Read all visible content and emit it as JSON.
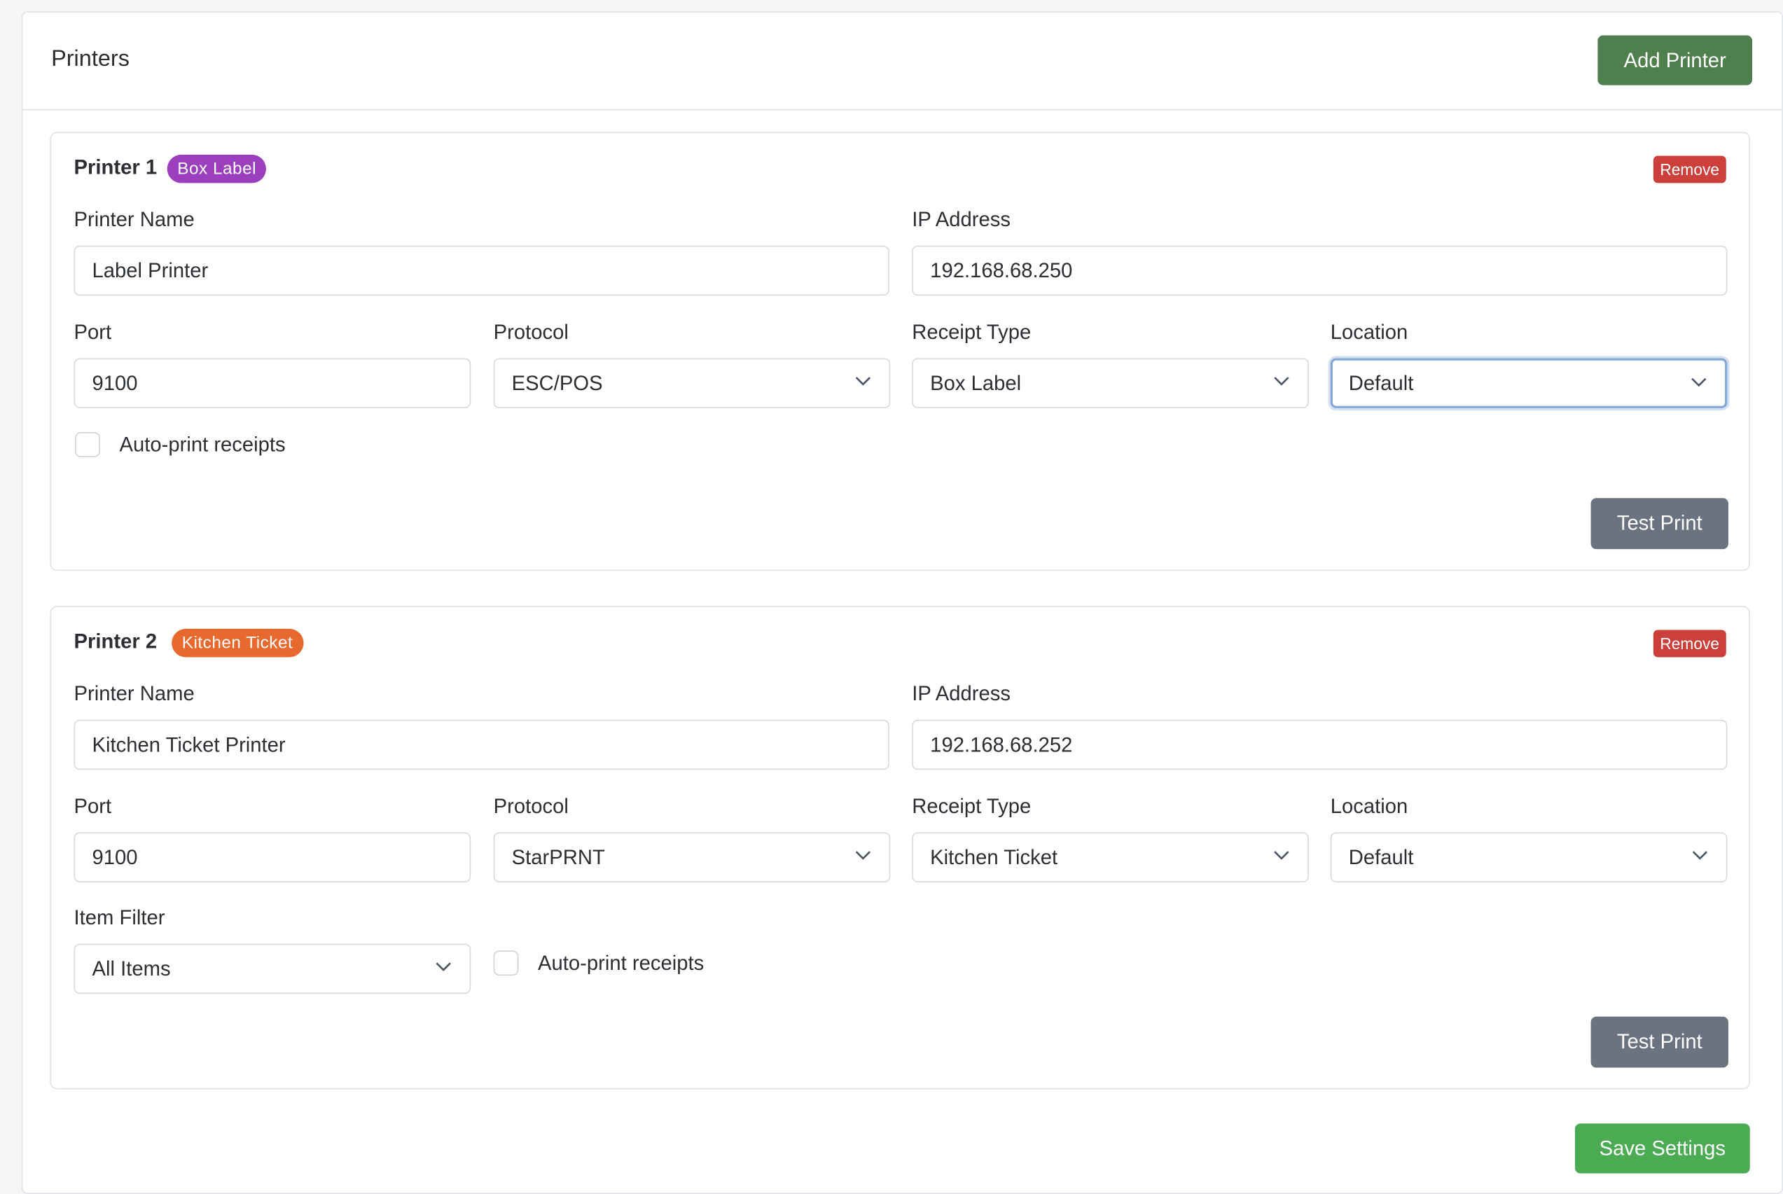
{
  "header": {
    "title": "Printers",
    "add_button": "Add Printer"
  },
  "labels": {
    "printer_name": "Printer Name",
    "ip_address": "IP Address",
    "port": "Port",
    "protocol": "Protocol",
    "receipt_type": "Receipt Type",
    "location": "Location",
    "item_filter": "Item Filter",
    "auto_print": "Auto-print receipts",
    "remove": "Remove",
    "test_print": "Test Print"
  },
  "printers": [
    {
      "title": "Printer 1",
      "badge": "Box Label",
      "badge_color": "#9c3fbf",
      "name": "Label Printer",
      "ip": "192.168.68.250",
      "port": "9100",
      "protocol": "ESC/POS",
      "receipt_type": "Box Label",
      "location": "Default",
      "auto_print": false
    },
    {
      "title": "Printer 2",
      "badge": "Kitchen Ticket",
      "badge_color": "#e8692d",
      "name": "Kitchen Ticket Printer",
      "ip": "192.168.68.252",
      "port": "9100",
      "protocol": "StarPRNT",
      "receipt_type": "Kitchen Ticket",
      "location": "Default",
      "item_filter": "All Items",
      "auto_print": false
    }
  ],
  "footer": {
    "save_button": "Save Settings"
  },
  "colors": {
    "add_button": "#4e7f4c",
    "remove_button": "#cc3f3a",
    "test_button": "#6b7280",
    "save_button": "#4bab52",
    "focus_ring": "#86a8d6"
  },
  "icons": {
    "select_arrow": "chevron-down-icon"
  }
}
